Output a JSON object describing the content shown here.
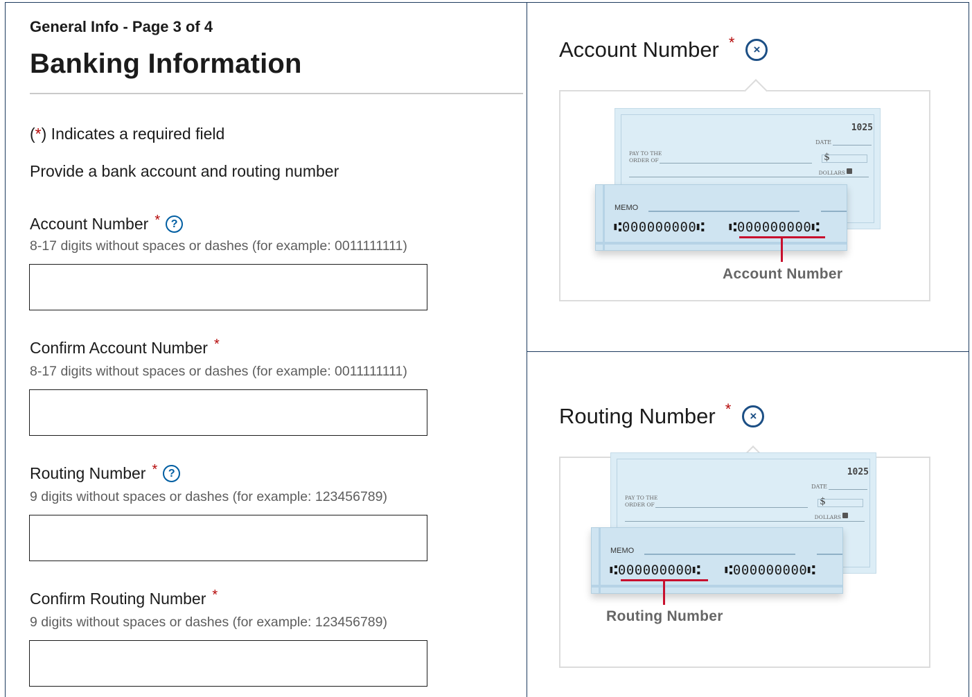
{
  "form": {
    "step_label": "General Info - Page 3 of 4",
    "page_title": "Banking Information",
    "required_note_prefix": "(",
    "required_note_star": "*",
    "required_note_suffix": ") Indicates a required field",
    "intro": "Provide a bank account and routing number",
    "fields": [
      {
        "label": "Account Number",
        "required": "*",
        "has_help": true,
        "help_glyph": "?",
        "hint": "8-17 digits without spaces or dashes (for example: 0011111111)",
        "value": ""
      },
      {
        "label": "Confirm Account Number",
        "required": "*",
        "has_help": false,
        "hint": "8-17 digits without spaces or dashes (for example: 0011111111)",
        "value": ""
      },
      {
        "label": "Routing Number",
        "required": "*",
        "has_help": true,
        "help_glyph": "?",
        "hint": "9 digits without spaces or dashes (for example: 123456789)",
        "value": ""
      },
      {
        "label": "Confirm Routing Number",
        "required": "*",
        "has_help": false,
        "hint": "9 digits without spaces or dashes (for example: 123456789)",
        "value": ""
      }
    ]
  },
  "tooltips": {
    "account": {
      "title": "Account Number",
      "required": "*",
      "close_glyph": "×",
      "callout": "Account Number"
    },
    "routing": {
      "title": "Routing Number",
      "required": "*",
      "close_glyph": "×",
      "callout": "Routing Number"
    }
  },
  "check": {
    "number": "1025",
    "date_label": "DATE",
    "pay_to_label_1": "PAY TO THE",
    "pay_to_label_2": "ORDER OF",
    "dollar_sign": "$",
    "dollars_label": "DOLLARS",
    "memo_label": "MEMO",
    "routing_micr": "⑆000000000⑆",
    "account_micr": "⑆000000000⑆"
  },
  "colors": {
    "frame": "#1c3a5e",
    "required_star": "#b50909",
    "help_blue": "#005ea2",
    "callout_red": "#c8102e"
  }
}
